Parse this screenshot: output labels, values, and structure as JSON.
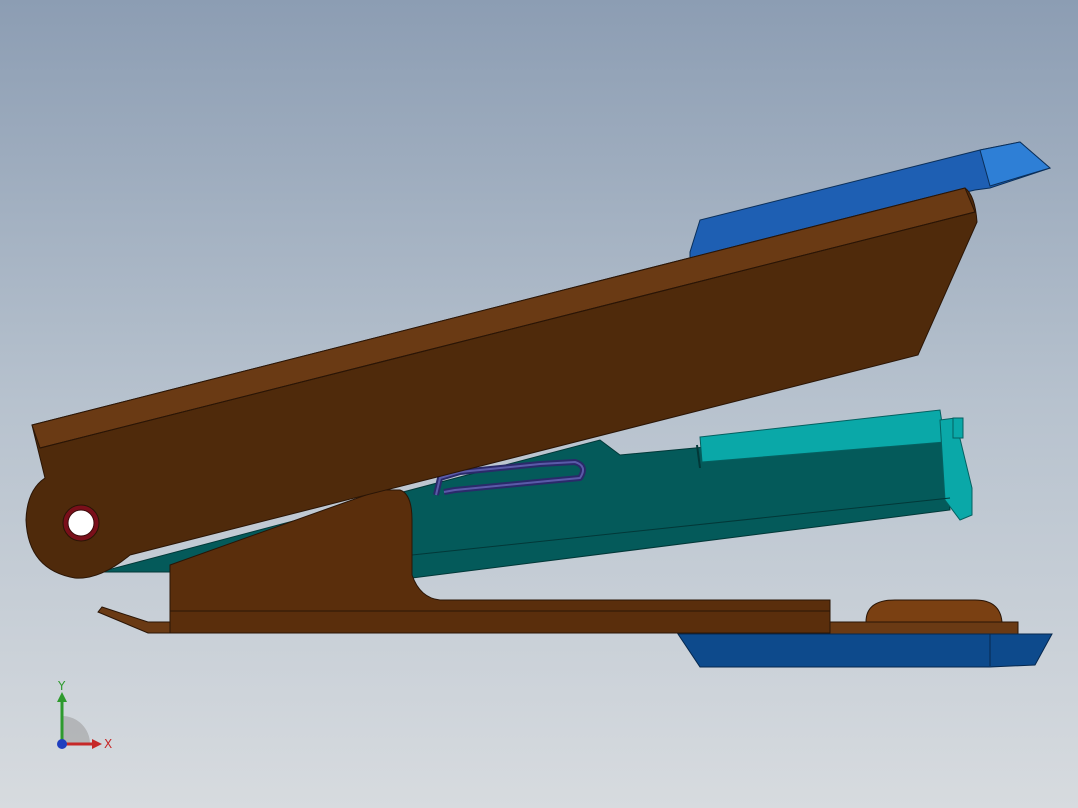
{
  "viewport": {
    "background_top": "#8c9db3",
    "background_bottom": "#d7dbdf"
  },
  "model": {
    "colors": {
      "handle": "#4f2a0b",
      "handle_edge": "#2a1506",
      "handle_top": "#6a3a14",
      "magazine": "#045a5a",
      "magazine_light": "#0aa8a8",
      "base": "#5a2e0c",
      "blue_top": "#1e5fb3",
      "blue_top_light": "#2e7fd6",
      "blue_bottom": "#0d4a8c",
      "wire": "#2a2a6a",
      "pivot_ring": "#7a0f1a"
    }
  },
  "triad": {
    "x_label": "X",
    "y_label": "Y",
    "x_color": "#c62828",
    "y_color": "#2e9a2e",
    "z_color": "#1f3fbf"
  }
}
